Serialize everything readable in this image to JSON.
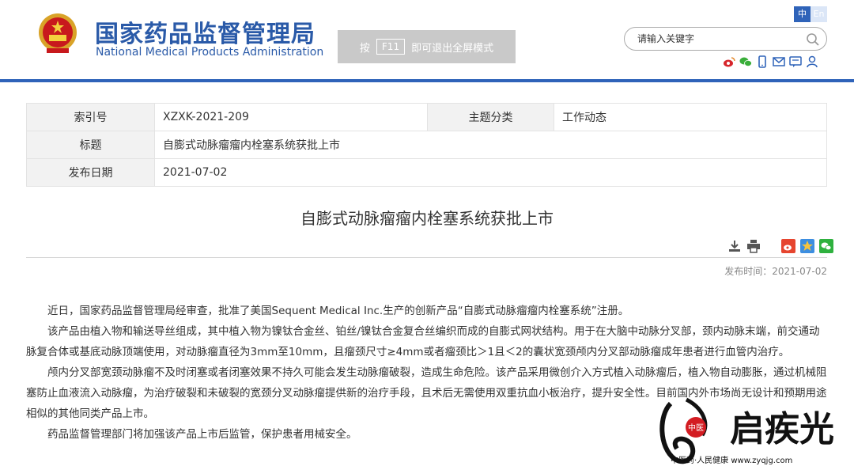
{
  "header": {
    "title_cn": "国家药品监督管理局",
    "title_en": "National Medical Products Administration",
    "fullscreen_tip": {
      "prefix": "按",
      "key": "F11",
      "suffix": "即可退出全屏模式"
    },
    "lang": {
      "zh": "中",
      "en": "En"
    },
    "search": {
      "placeholder": "请输入关键字"
    }
  },
  "meta": {
    "index_label": "索引号",
    "index_value": "XZXK-2021-209",
    "category_label": "主题分类",
    "category_value": "工作动态",
    "title_label": "标题",
    "title_value": "自膨式动脉瘤瘤内栓塞系统获批上市",
    "date_label": "发布日期",
    "date_value": "2021-07-02"
  },
  "article": {
    "title": "自膨式动脉瘤瘤内栓塞系统获批上市",
    "pubtime": "发布时间：2021-07-02",
    "paragraphs": [
      "近日，国家药品监督管理局经审查，批准了美国Sequent Medical Inc.生产的创新产品“自膨式动脉瘤瘤内栓塞系统”注册。",
      "该产品由植入物和输送导丝组成，其中植入物为镍钛合金丝、铂丝/镍钛合金复合丝编织而成的自膨式网状结构。用于在大脑中动脉分叉部，颈内动脉末端，前交通动脉复合体或基底动脉顶端使用，对动脉瘤直径为3mm至10mm，且瘤颈尺寸≥4mm或者瘤颈比＞1且＜2的囊状宽颈颅内分叉部动脉瘤成年患者进行血管内治疗。",
      "颅内分叉部宽颈动脉瘤不及时闭塞或者闭塞效果不持久可能会发生动脉瘤破裂，造成生命危险。该产品采用微创介入方式植入动脉瘤后，植入物自动膨胀，通过机械阻塞防止血液流入动脉瘤，为治疗破裂和未破裂的宽颈分叉动脉瘤提供新的治疗手段，且术后无需使用双重抗血小板治疗，提升安全性。目前国内外市场尚无设计和预期用途相似的其他同类产品上市。",
      "药品监督管理部门将加强该产品上市后监管，保护患者用械安全。"
    ]
  },
  "watermark": {
    "text": "启疾光",
    "stamp": "中医",
    "footer": "中医药·人民健康 www.zyqjg.com"
  },
  "colors": {
    "brand": "#2a5aa8",
    "header_line": "#2f63b9",
    "table_key_bg": "#f2f2f2"
  },
  "icons": [
    "emblem-icon",
    "search-icon",
    "weibo-icon",
    "wechat-icon",
    "mobile-icon",
    "mail-icon",
    "message-icon",
    "user-icon",
    "download-icon",
    "print-icon",
    "share-weibo-icon",
    "share-qzone-icon",
    "share-wechat-icon"
  ]
}
